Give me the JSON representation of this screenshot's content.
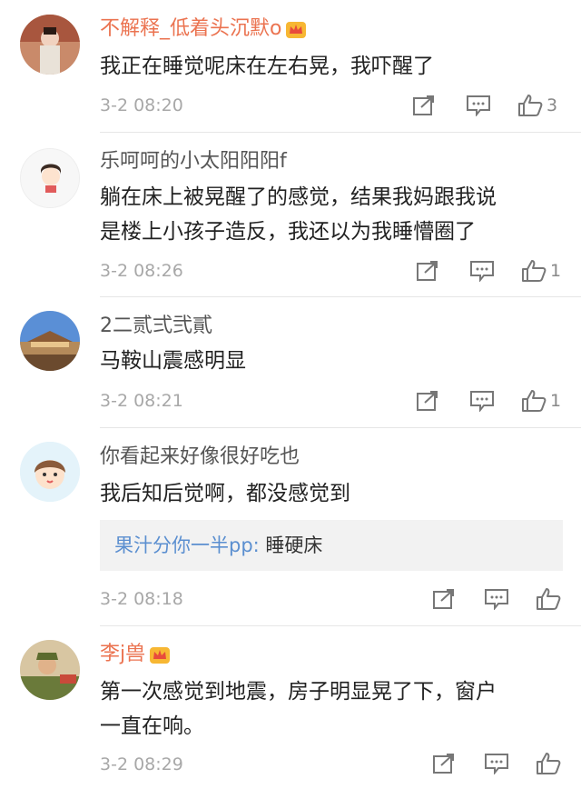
{
  "comments": [
    {
      "username": "不解释_低着头沉默o",
      "vip": true,
      "text_lines": [
        "我正在睡觉呢床在左右晃，我吓醒了"
      ],
      "time": "3-2 08:20",
      "likes": "3",
      "avatar_icon": "user-photo-icon"
    },
    {
      "username": "乐呵呵的小太阳阳阳f",
      "vip": false,
      "text_lines": [
        "躺在床上被晃醒了的感觉，结果我妈跟我说",
        "是楼上小孩子造反，我还以为我睡懵圈了"
      ],
      "time": "3-2 08:26",
      "likes": "1",
      "avatar_icon": "cartoon-girl-icon"
    },
    {
      "username": "2二贰弍弐貳",
      "vip": false,
      "text_lines": [
        "马鞍山震感明显"
      ],
      "time": "3-2 08:21",
      "likes": "1",
      "avatar_icon": "landscape-photo-icon"
    },
    {
      "username": "你看起来好像很好吃也",
      "vip": false,
      "text_lines": [
        "我后知后觉啊，都没感觉到"
      ],
      "reply": {
        "user": "果汁分你一半pp:",
        "text": " 睡硬床"
      },
      "time": "3-2 08:18",
      "likes": "",
      "avatar_icon": "cartoon-doll-icon"
    },
    {
      "username": "李j兽",
      "vip": true,
      "text_lines": [
        "第一次感觉到地震，房子明显晃了下，窗户",
        "一直在响。"
      ],
      "time": "3-2 08:29",
      "likes": "",
      "avatar_icon": "soldier-photo-icon"
    }
  ],
  "colors": {
    "vip_name": "#eb7350",
    "reply_user": "#5b8fd0",
    "time": "#a8a8a8"
  }
}
